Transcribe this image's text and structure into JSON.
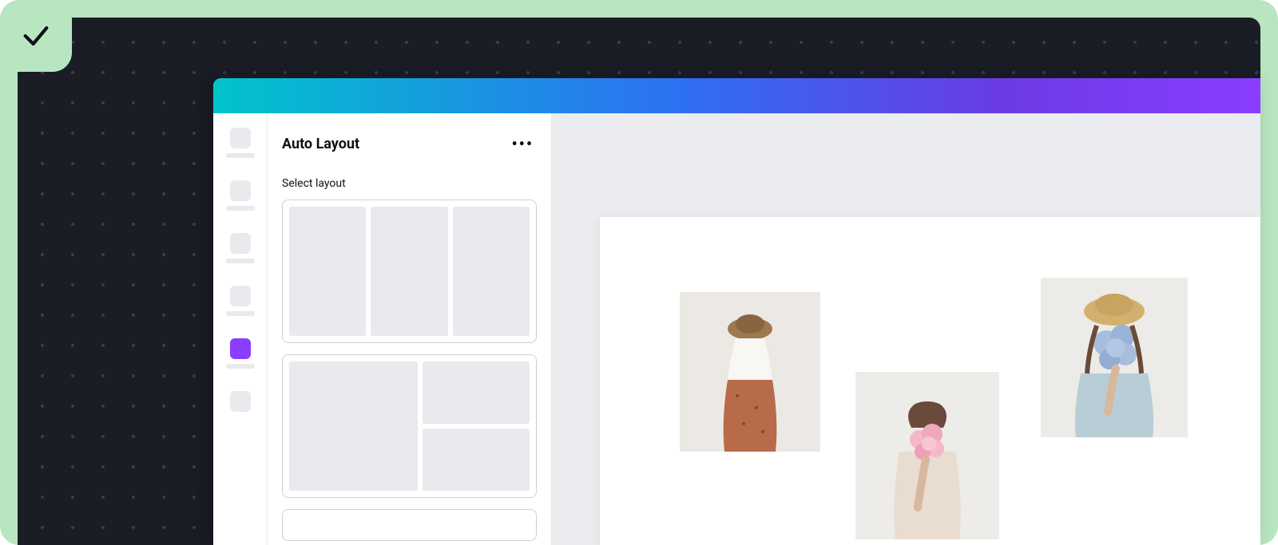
{
  "frame": {
    "status": "approved"
  },
  "panel": {
    "title": "Auto Layout",
    "section_label": "Select layout"
  },
  "rail": {
    "items": [
      {
        "name": "design"
      },
      {
        "name": "elements"
      },
      {
        "name": "uploads"
      },
      {
        "name": "text"
      },
      {
        "name": "auto-layout",
        "active": true
      },
      {
        "name": "more"
      }
    ]
  },
  "layouts": [
    {
      "id": "three-columns"
    },
    {
      "id": "one-two-stack"
    },
    {
      "id": "next"
    }
  ],
  "canvas": {
    "photos": [
      {
        "name": "photo-hat-skirt"
      },
      {
        "name": "photo-pink-flowers"
      },
      {
        "name": "photo-blue-flowers-hat"
      }
    ]
  }
}
